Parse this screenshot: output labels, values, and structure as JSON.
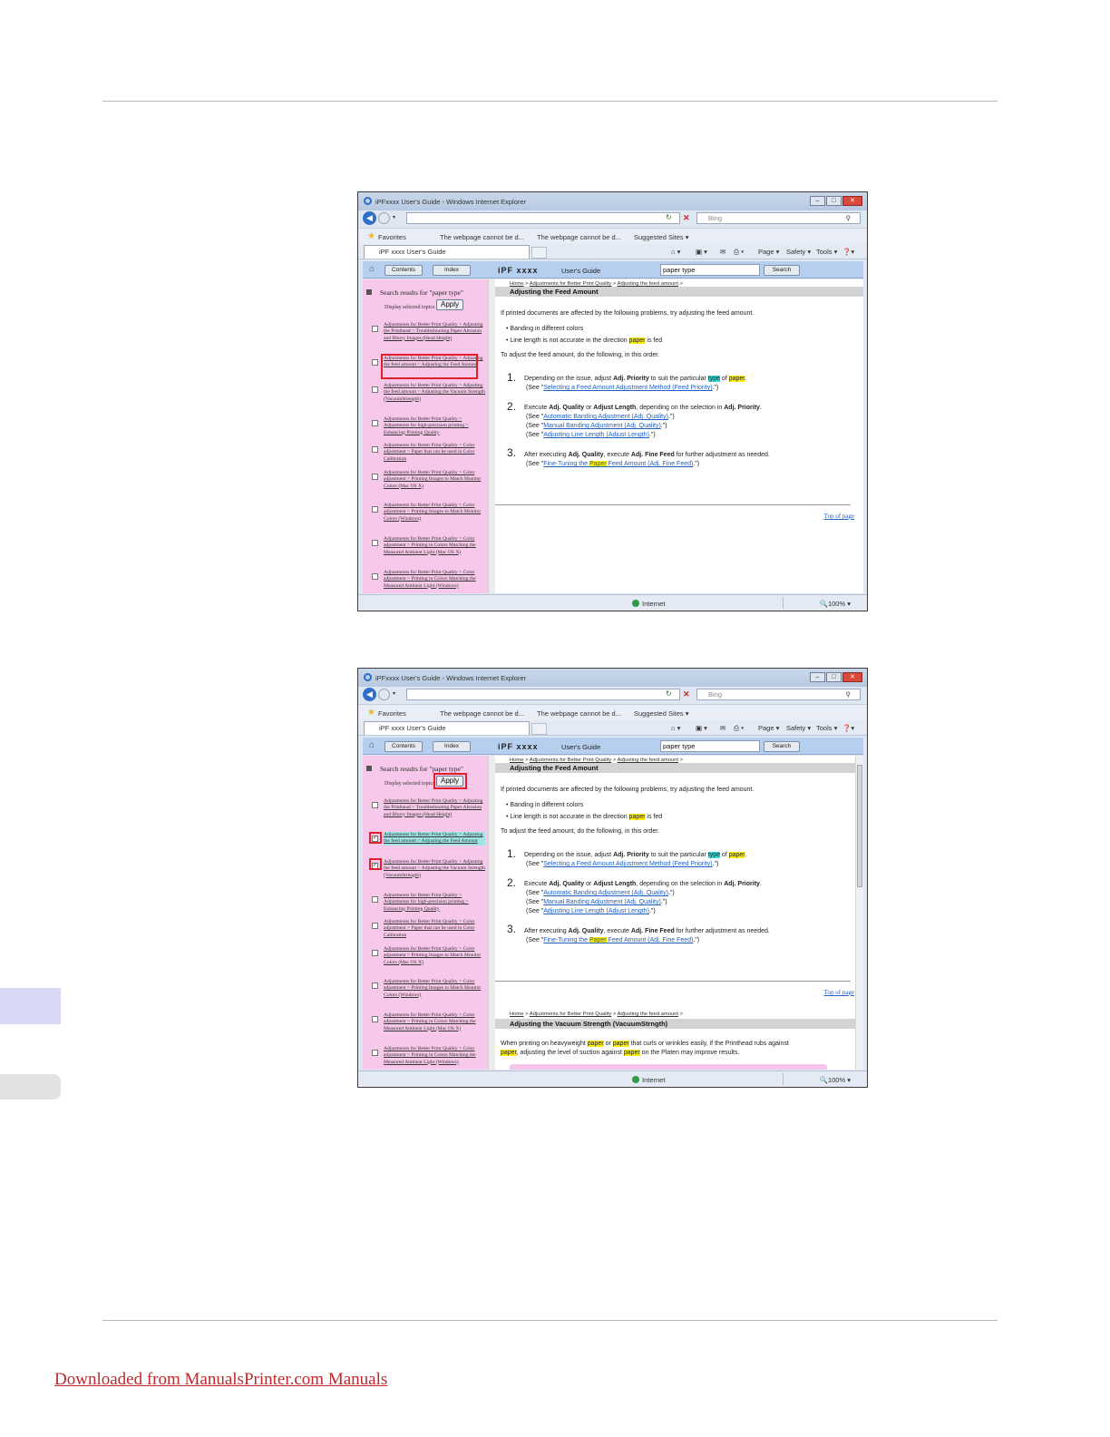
{
  "page": {
    "footer_link": "Downloaded from ManualsPrinter.com Manuals"
  },
  "browser": {
    "title": "iPFxxxx User's Guide - Windows Internet Explorer",
    "search_placeholder": "Bing",
    "favorites_label": "Favorites",
    "fav_item_1": "The webpage cannot be d...",
    "fav_item_2": "The webpage cannot be d...",
    "suggested_sites": "Suggested Sites ▾",
    "tab_title": "iPF xxxx User's Guide",
    "cmd_page": "Page ▾",
    "cmd_safety": "Safety ▾",
    "cmd_tools": "Tools ▾",
    "status_zone": "Internet",
    "zoom": "100%"
  },
  "help_nav": {
    "contents": "Contents",
    "index": "Index",
    "brand": "iPF xxxx",
    "guide": "User's Guide",
    "search_value": "paper type",
    "search_button": "Search"
  },
  "sidebar": {
    "heading": "Search results for \"paper type\"",
    "display_selected": "Display selected topics",
    "apply": "Apply",
    "results": [
      "Adjustments for Better Print Quality > Adjusting the Printhead > Troubleshooting Paper Abrasion and Blurry Images (Head Height)",
      "Adjustments for Better Print Quality > Adjusting the feed amount > Adjusting the Feed Amount",
      "Adjustments for Better Print Quality > Adjusting the feed amount > Adjusting the Vacuum Strength (VacuumStrength)",
      "Adjustments for Better Print Quality > Adjustments for high-precision printing > Enhancing Printing Quality",
      "Adjustments for Better Print Quality > Color adjustment > Paper that can be used in Color Calibration",
      "Adjustments for Better Print Quality > Color adjustment > Printing Images to Match Monitor Colors (Mac OS X)",
      "Adjustments for Better Print Quality > Color adjustment > Printing Images to Match Monitor Colors (Windows)",
      "Adjustments for Better Print Quality > Color adjustment > Printing in Colors Matching the Measured Ambient Light (Mac OS X)",
      "Adjustments for Better Print Quality > Color adjustment > Printing in Colors Matching the Measured Ambient Light (Windows)"
    ]
  },
  "content": {
    "crumb_home": "Home",
    "crumb_1": "Adjustments for Better Print Quality",
    "crumb_2": "Adjusting the feed amount",
    "title": "Adjusting the Feed Amount",
    "intro": "If printed documents are affected by the following problems, try adjusting the feed amount.",
    "bullet_1": "Banding in different colors",
    "bullet_2_pre": "Line length is not accurate in the direction ",
    "bullet_2_kw": "paper",
    "bullet_2_post": " is fed",
    "lead": "To adjust the feed amount, do the following, in this order.",
    "step1_pre": "Depending on the issue, adjust ",
    "step1_bold": "Adj. Priority",
    "step1_mid": " to suit the particular ",
    "step1_kw1": "type",
    "step1_of": " of ",
    "step1_kw2": "paper",
    "step1_end": ".",
    "step1_see": "Selecting a Feed Amount Adjustment Method (Feed Priority)",
    "step2_pre": "Execute ",
    "step2_b1": "Adj. Quality",
    "step2_or": " or ",
    "step2_b2": "Adjust Length",
    "step2_mid": ", depending on the selection in ",
    "step2_b3": "Adj. Priority",
    "step2_end": ".",
    "step2_see1": "Automatic Banding Adjustment (Adj. Quality)",
    "step2_see2": "Manual Banding Adjustment (Adj. Quality)",
    "step2_see3": "Adjusting Line Length (Adjust Length)",
    "step3_pre": "After executing ",
    "step3_b1": "Adj. Quality",
    "step3_mid": ", execute ",
    "step3_b2": "Adj. Fine Feed",
    "step3_end": " for further adjustment as needed.",
    "step3_see_pre": "Fine-Tuning the ",
    "step3_see_kw": "Paper",
    "step3_see_post": " Feed Amount (Adj. Fine Feed)",
    "see_open": "(See \"",
    "see_close": ".\")",
    "top_of_page": "Top of page",
    "section2_title": "Adjusting the Vacuum Strength (VacuumStrngth)",
    "section2_text_pre": "When printing on heavyweight ",
    "section2_kw1": "paper",
    "section2_or": " or ",
    "section2_kw2": "paper",
    "section2_mid": " that curls or wrinkles easily, if the Printhead rubs against",
    "section2_kw3": "paper",
    "section2_mid2": ", adjusting the level of suction against ",
    "section2_kw4": "paper",
    "section2_end": " on the Platen may improve results."
  },
  "numbers": {
    "step1": "1.",
    "step2": "2.",
    "step3": "3."
  },
  "colors": {
    "sidebar_bg": "#f7c8e9",
    "highlight_box": "#e0202a",
    "keyword_yellow": "#ffee00",
    "keyword_cyan": "#38d8d8",
    "side_tab": "#d8d8f4"
  }
}
